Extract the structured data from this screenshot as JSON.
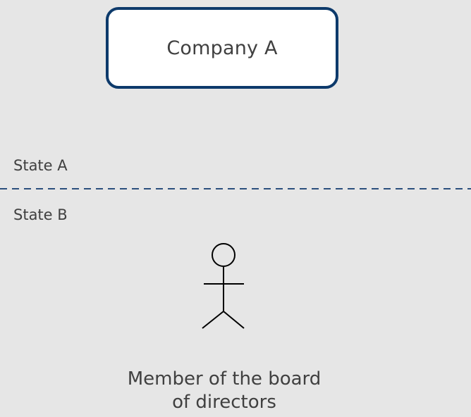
{
  "company": {
    "label": "Company A"
  },
  "states": {
    "top_label": "State A",
    "bottom_label": "State B"
  },
  "person": {
    "icon": "stick-figure-icon",
    "caption_line1": "Member of the board",
    "caption_line2": "of directors"
  },
  "colors": {
    "background": "#e6e6e6",
    "box_border": "#0d3a6b",
    "box_fill": "#ffffff",
    "divider": "#2b4f7d",
    "text": "#404040"
  }
}
